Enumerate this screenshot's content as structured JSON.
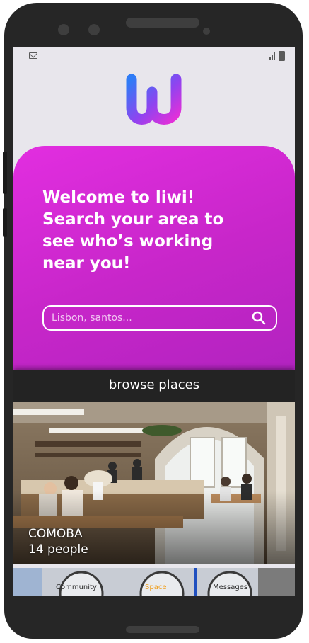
{
  "status_bar": {
    "left_icon": "mail-icon",
    "right_icons": [
      "signal-icon",
      "battery-icon"
    ]
  },
  "brand": {
    "logo_letter": "W",
    "logo_colors": [
      "#2f7cf6",
      "#8e44f0",
      "#e52fd8"
    ]
  },
  "hero": {
    "title_lines": [
      "Welcome to liwi!",
      "Search your area to",
      "see who’s working",
      "near you!"
    ],
    "background": "#d12bd4"
  },
  "search": {
    "placeholder": "Lisbon, santos...",
    "icon": "search-icon"
  },
  "browse": {
    "title": "browse places"
  },
  "places": [
    {
      "name": "COMOBA",
      "people": "14 people"
    }
  ],
  "tabs": [
    {
      "label": "Community",
      "color": "#2a2a2a"
    },
    {
      "label": "Space",
      "color": "#f0a020"
    },
    {
      "label": "Messages",
      "color": "#2a2a2a"
    }
  ]
}
